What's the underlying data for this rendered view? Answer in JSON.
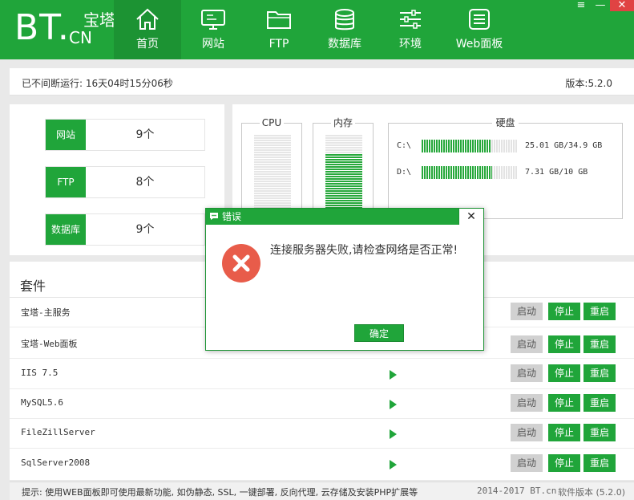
{
  "header": {
    "logo_main": "BT.",
    "logo_cn_top": "宝塔",
    "logo_cn_bottom": "CN",
    "nav": [
      {
        "label": "首页",
        "icon": "home-icon",
        "active": true
      },
      {
        "label": "网站",
        "icon": "monitor-icon"
      },
      {
        "label": "FTP",
        "icon": "folder-icon"
      },
      {
        "label": "数据库",
        "icon": "database-icon"
      },
      {
        "label": "环境",
        "icon": "sliders-icon"
      },
      {
        "label": "Web面板",
        "icon": "list-panel-icon"
      }
    ],
    "window_controls": {
      "menu": "≡",
      "minimize": "—",
      "close": "✕"
    }
  },
  "infobar": {
    "uptime": "已不间断运行: 16天04时15分06秒",
    "version": "版本:5.2.0"
  },
  "stats": [
    {
      "label": "网站",
      "value": "9个"
    },
    {
      "label": "FTP",
      "value": "8个"
    },
    {
      "label": "数据库",
      "value": "9个"
    }
  ],
  "system": {
    "cpu": {
      "title": "CPU",
      "usage_fraction": 0.0
    },
    "memory": {
      "title": "内存",
      "usage_fraction": 0.76
    },
    "disk": {
      "title": "硬盘",
      "drives": [
        {
          "name": "C:\\",
          "text": "25.01 GB/34.9 GB",
          "usage_fraction": 0.72
        },
        {
          "name": "D:\\",
          "text": "7.31 GB/10 GB",
          "usage_fraction": 0.73
        }
      ]
    }
  },
  "software": {
    "title": "套件",
    "rows": [
      {
        "name": "宝塔-主服务",
        "start": "启动",
        "stop": "停止",
        "restart": "重启",
        "running": false
      },
      {
        "name": "宝塔-Web面板",
        "start": "启动",
        "stop": "停止",
        "restart": "重启",
        "running": false
      },
      {
        "name": "IIS 7.5",
        "start": "启动",
        "stop": "停止",
        "restart": "重启",
        "running": true
      },
      {
        "name": "MySQL5.6",
        "start": "启动",
        "stop": "停止",
        "restart": "重启",
        "running": true
      },
      {
        "name": "FileZillServer",
        "start": "启动",
        "stop": "停止",
        "restart": "重启",
        "running": true
      },
      {
        "name": "SqlServer2008",
        "start": "启动",
        "stop": "停止",
        "restart": "重启",
        "running": true
      }
    ]
  },
  "footer": {
    "tip": "提示: 使用WEB面板即可使用最新功能, 如伪静态, SSL, 一键部署, 反向代理, 云存储及安装PHP扩展等",
    "copyright": "2014-2017 BT.cn",
    "software_version": "软件版本 (5.2.0)"
  },
  "dialog": {
    "title": "错误",
    "close": "✕",
    "message": "连接服务器失败,请检查网络是否正常!",
    "ok_label": "确定"
  },
  "colors": {
    "brand_green": "#20a53a",
    "active_nav": "#1c9333",
    "error_red": "#e85c4a"
  }
}
